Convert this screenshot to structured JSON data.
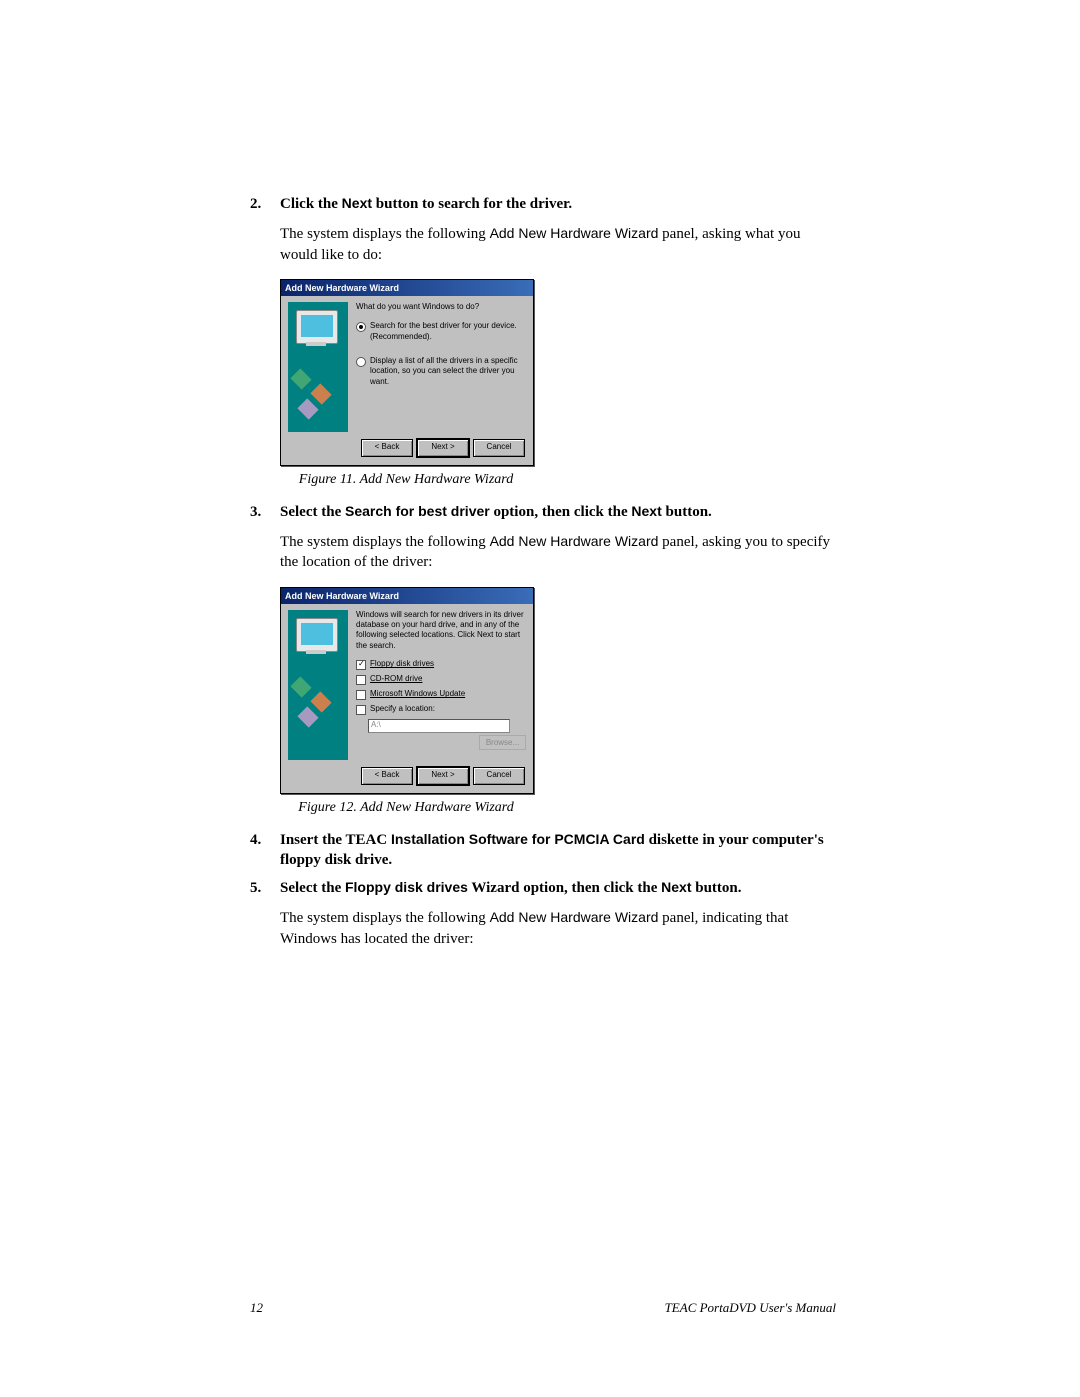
{
  "steps": {
    "s2": {
      "num": "2.",
      "lead_a": "Click the ",
      "lead_sans": "Next",
      "lead_b": " button to search for the driver.",
      "para_a": "The system displays the following ",
      "para_sans": "Add New Hardware Wizard",
      "para_b": " panel, asking what you would like to do:"
    },
    "s3": {
      "num": "3.",
      "lead_a": "Select the ",
      "lead_sans": "Search for best driver",
      "lead_b": " option, then click the ",
      "lead_sans2": "Next",
      "lead_c": " button.",
      "para_a": "The system displays the following ",
      "para_sans": "Add New Hardware Wizard",
      "para_b": " panel, asking you to specify the location of the driver:"
    },
    "s4": {
      "num": "4.",
      "lead_a": "Insert the TEAC ",
      "lead_sans": "Installation Software for PCMCIA Card",
      "lead_b": " diskette in your computer's floppy disk drive."
    },
    "s5": {
      "num": "5.",
      "lead_a": "Select the ",
      "lead_sans": "Floppy disk drives",
      "lead_b": " Wizard option, then click the ",
      "lead_sans2": "Next",
      "lead_c": " button.",
      "para_a": "The system displays the following ",
      "para_sans": "Add New Hardware Wizard",
      "para_b": " panel, indicating that Windows has located the driver:"
    }
  },
  "dialog1": {
    "title": "Add New Hardware Wizard",
    "prompt": "What do you want Windows to do?",
    "opt1": "Search for the best driver for your device. (Recommended).",
    "opt2": "Display a list of all the drivers in a specific location, so you can select the driver you want.",
    "back": "< Back",
    "next": "Next >",
    "cancel": "Cancel"
  },
  "dialog2": {
    "title": "Add New Hardware Wizard",
    "prompt": "Windows will search for new drivers in its driver database on your hard drive, and in any of the following selected locations. Click Next to start the search.",
    "o1": "Floppy disk drives",
    "o2": "CD-ROM drive",
    "o3": "Microsoft Windows Update",
    "o4": "Specify a location:",
    "path": "A:\\",
    "browse": "Browse...",
    "back": "< Back",
    "next": "Next >",
    "cancel": "Cancel"
  },
  "captions": {
    "f11": "Figure 11. Add New Hardware Wizard",
    "f12": "Figure 12. Add New Hardware Wizard"
  },
  "footer": {
    "page": "12",
    "doc": "TEAC PortaDVD User's Manual"
  }
}
